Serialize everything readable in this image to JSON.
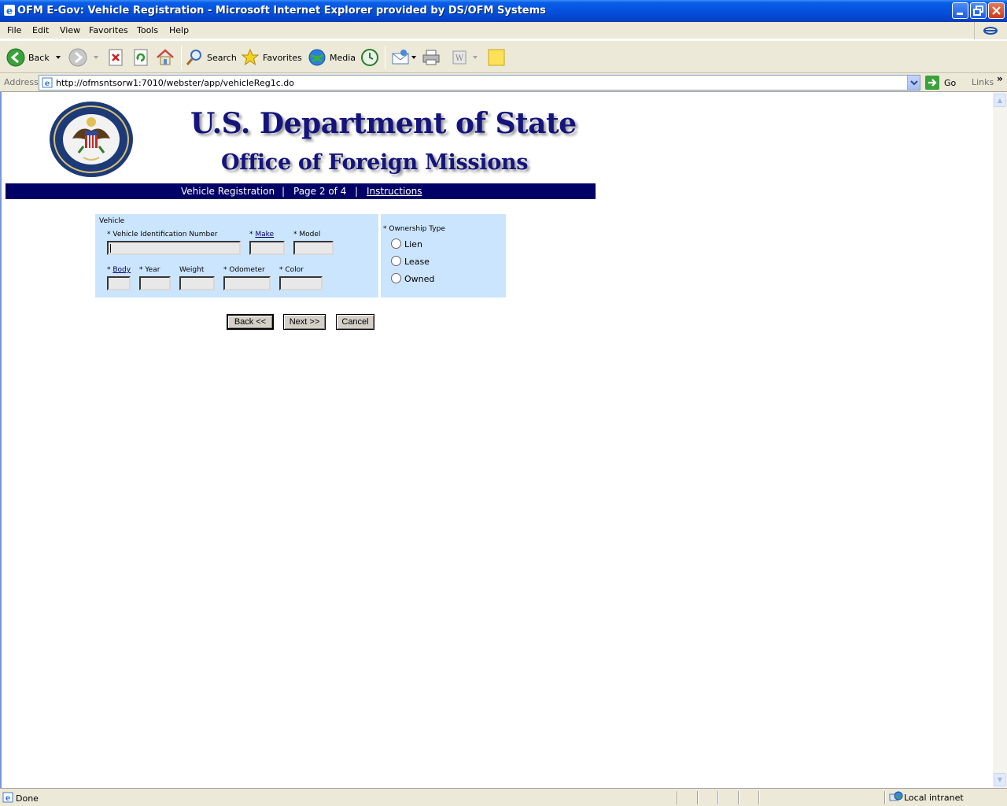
{
  "window": {
    "title": "OFM E-Gov: Vehicle Registration - Microsoft Internet Explorer provided by DS/OFM Systems",
    "controls": [
      "minimize",
      "maximize",
      "close"
    ]
  },
  "menu": [
    "File",
    "Edit",
    "View",
    "Favorites",
    "Tools",
    "Help"
  ],
  "toolbar": {
    "back_label": "Back",
    "search_label": "Search",
    "favorites_label": "Favorites",
    "media_label": "Media"
  },
  "address": {
    "label": "Address",
    "url": "http://ofmsntsorw1:7010/webster/app/vehicleReg1c.do",
    "go_label": "Go",
    "links_label": "Links"
  },
  "page": {
    "heading": "U.S. Department of State",
    "subheading": "Office of Foreign Missions",
    "nav": {
      "section": "Vehicle Registration",
      "sep1": "|",
      "page": "Page 2 of 4",
      "sep2": "|",
      "instructions": "Instructions"
    },
    "vehicle_section": {
      "title": "Vehicle",
      "vin_label": "* Vehicle Identification Number",
      "make_prefix": "* ",
      "make_label": "Make",
      "model_label": "* Model",
      "body_prefix": "* ",
      "body_label": "Body",
      "year_label": "* Year",
      "weight_label": "Weight",
      "odometer_label": "* Odometer",
      "color_label": "* Color"
    },
    "ownership": {
      "title": "* Ownership Type",
      "options": [
        "Lien",
        "Lease",
        "Owned"
      ]
    },
    "buttons": {
      "back": "Back <<",
      "next": "Next >>",
      "cancel": "Cancel"
    }
  },
  "status": {
    "text": "Done",
    "zone": "Local intranet"
  }
}
